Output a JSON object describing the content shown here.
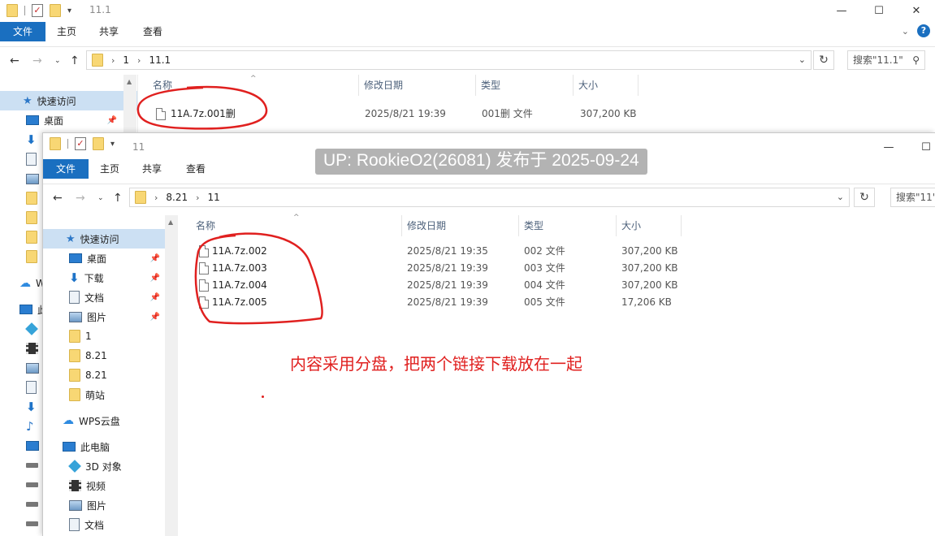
{
  "back_window": {
    "title": "11.1",
    "ribbon_tabs": [
      "文件",
      "主页",
      "共享",
      "查看"
    ],
    "breadcrumb": [
      "1",
      "11.1"
    ],
    "search_placeholder": "搜索\"11.1\"",
    "columns": [
      "名称",
      "修改日期",
      "类型",
      "大小"
    ],
    "files": [
      {
        "name": "11A.7z.001删",
        "modified": "2025/8/21 19:39",
        "type": "001删 文件",
        "size": "307,200 KB"
      }
    ],
    "nav_items": {
      "quick_access": "快速访问",
      "desktop": "桌面",
      "wps": "W",
      "this_pc": "此"
    }
  },
  "front_window": {
    "title": "11",
    "ribbon_tabs": [
      "文件",
      "主页",
      "共享",
      "查看"
    ],
    "breadcrumb": [
      "8.21",
      "11"
    ],
    "search_placeholder": "搜索\"11\"",
    "columns": [
      "名称",
      "修改日期",
      "类型",
      "大小"
    ],
    "files": [
      {
        "name": "11A.7z.002",
        "modified": "2025/8/21 19:35",
        "type": "002 文件",
        "size": "307,200 KB"
      },
      {
        "name": "11A.7z.003",
        "modified": "2025/8/21 19:39",
        "type": "003 文件",
        "size": "307,200 KB"
      },
      {
        "name": "11A.7z.004",
        "modified": "2025/8/21 19:39",
        "type": "004 文件",
        "size": "307,200 KB"
      },
      {
        "name": "11A.7z.005",
        "modified": "2025/8/21 19:39",
        "type": "005 文件",
        "size": "17,206 KB"
      }
    ],
    "nav_items": {
      "quick_access": "快速访问",
      "desktop": "桌面",
      "downloads": "下载",
      "documents": "文档",
      "pictures": "图片",
      "folder_1": "1",
      "folder_821a": "8.21",
      "folder_821b": "8.21",
      "folder_mengzhan": "萌站",
      "wps_cloud": "WPS云盘",
      "this_pc": "此电脑",
      "objects_3d": "3D 对象",
      "videos": "视频",
      "pictures_pc": "图片",
      "documents_pc": "文档"
    }
  },
  "overlay": {
    "watermark": "UP: RookieO2(26081) 发布于 2025-09-24",
    "annotation": "内容采用分盘，把两个链接下载放在一起"
  },
  "colors": {
    "file_tab": "#1a6fc0",
    "selection": "#cce0f3",
    "annotation_red": "#e0201f"
  }
}
